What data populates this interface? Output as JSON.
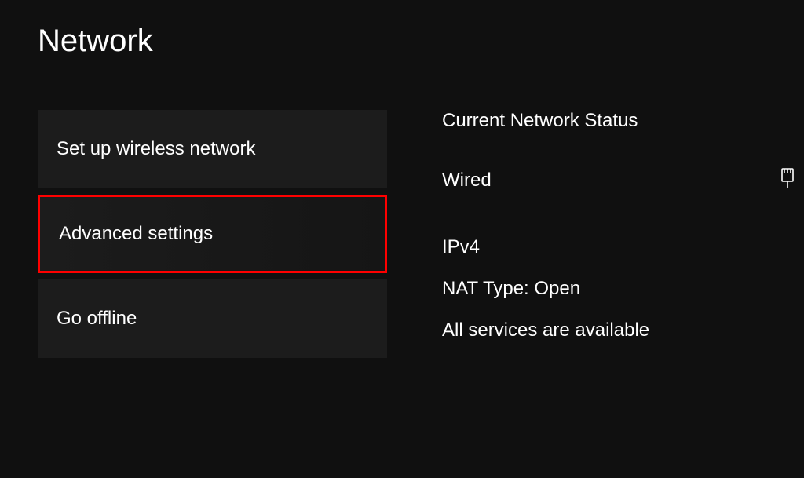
{
  "page": {
    "title": "Network"
  },
  "menu": {
    "items": [
      {
        "label": "Set up wireless network"
      },
      {
        "label": "Advanced settings"
      },
      {
        "label": "Go offline"
      }
    ]
  },
  "status": {
    "heading": "Current Network Status",
    "connection_type": "Wired",
    "ip_version": "IPv4",
    "nat_type": "NAT Type: Open",
    "services": "All services are available"
  },
  "icons": {
    "wired": "wired-icon"
  }
}
